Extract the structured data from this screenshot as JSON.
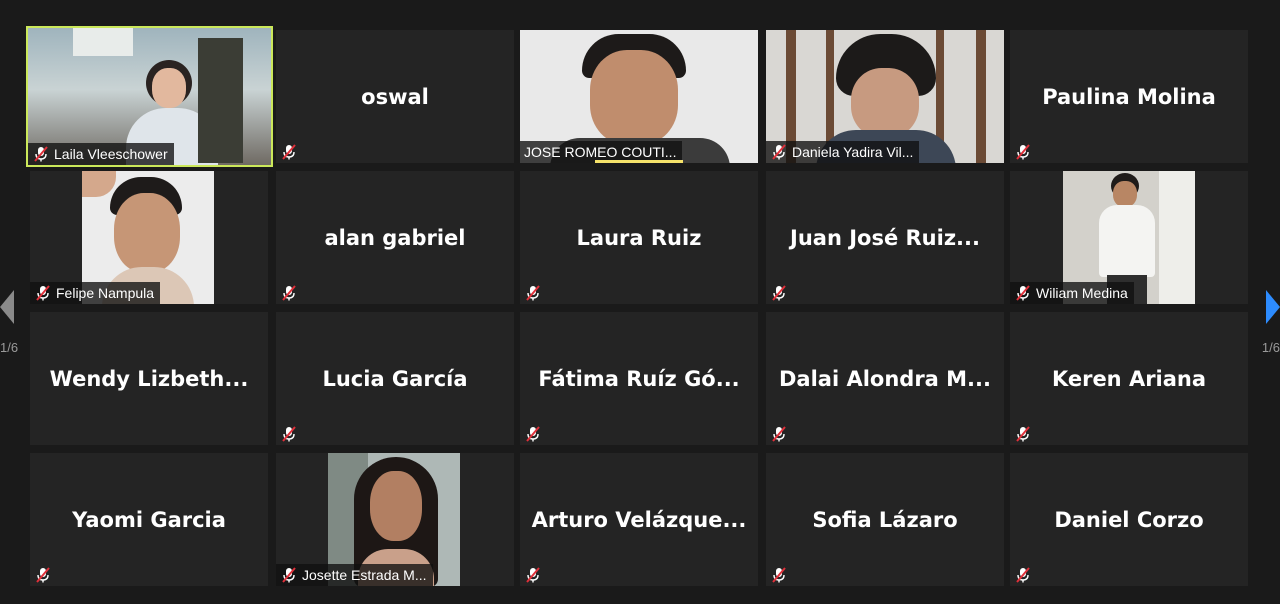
{
  "participants": [
    {
      "name": "Laila Vleeschower"
    },
    {
      "name": "oswal"
    },
    {
      "name": "JOSE ROMEO COUTI..."
    },
    {
      "name": "Daniela Yadira Vil..."
    },
    {
      "name": "Paulina Molina"
    },
    {
      "name": "Felipe Nampula"
    },
    {
      "name": "alan gabriel"
    },
    {
      "name": "Laura Ruiz"
    },
    {
      "name": "Juan José Ruiz..."
    },
    {
      "name": "Wiliam Medina"
    },
    {
      "name": "Wendy  Lizbeth..."
    },
    {
      "name": "Lucia García"
    },
    {
      "name": "Fátima  Ruíz  Gó..."
    },
    {
      "name": "Dalai  Alondra  M..."
    },
    {
      "name": "Keren Ariana"
    },
    {
      "name": "Yaomi Garcia"
    },
    {
      "name": "Josette Estrada M..."
    },
    {
      "name": "Arturo  Velázque..."
    },
    {
      "name": "Sofia Lázaro"
    },
    {
      "name": "Daniel Corzo"
    }
  ],
  "pagination": {
    "left": "1/6",
    "right": "1/6"
  },
  "colors": {
    "active_border": "#cbe85a",
    "muted_icon": "#e0303a",
    "next_arrow": "#2d8cff"
  }
}
